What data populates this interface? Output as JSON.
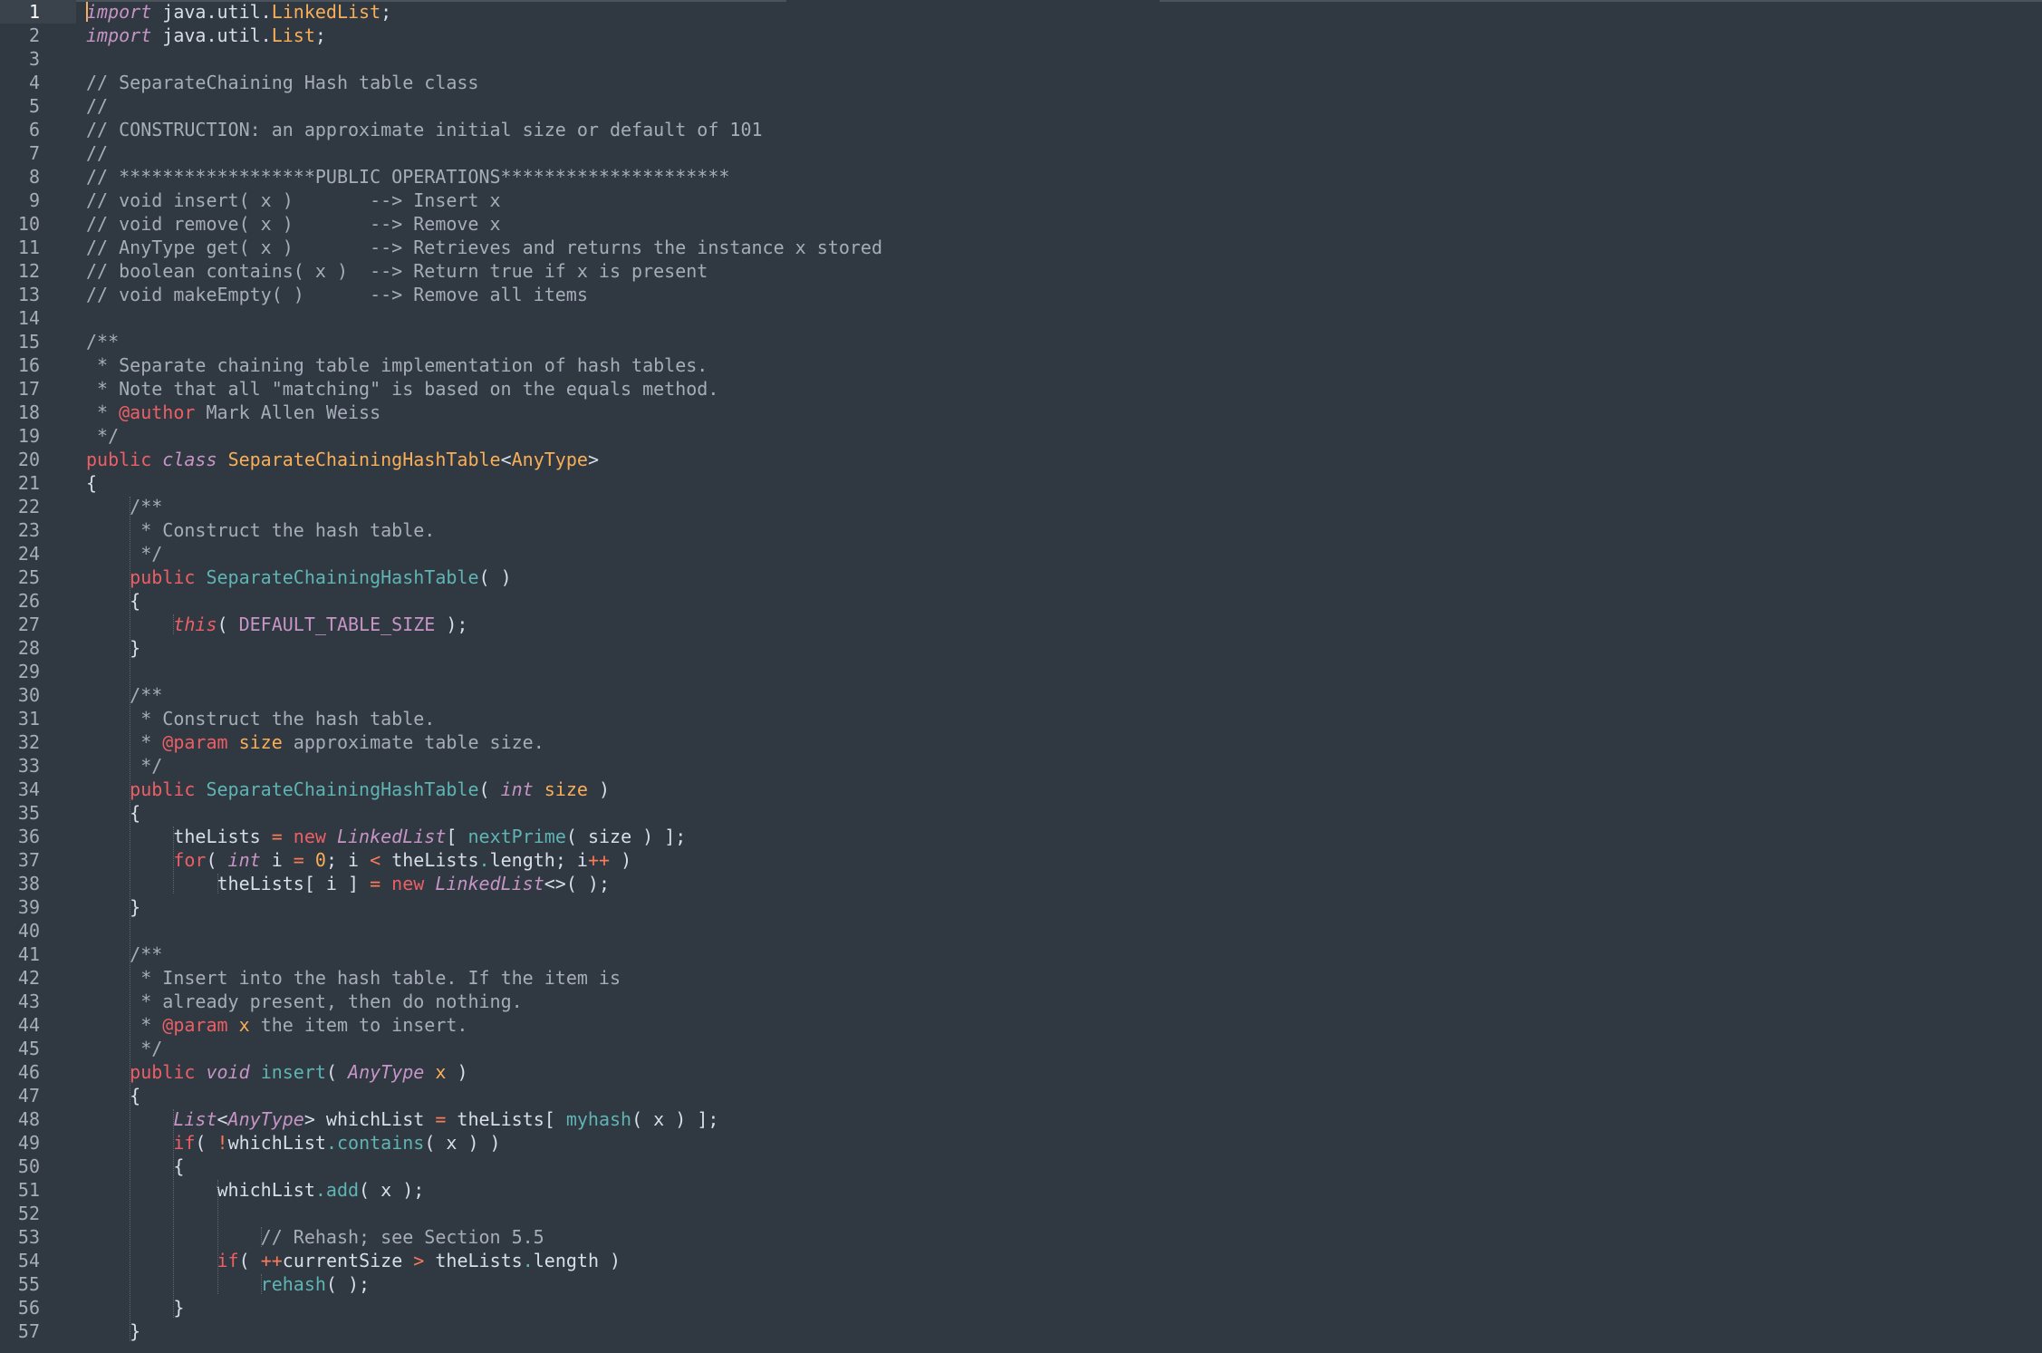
{
  "editor": {
    "current_line": 1,
    "theme_colors": {
      "background": "#303841",
      "gutter_text": "#a7adba",
      "keyword": "#ec5f66",
      "storage": "#c695c6",
      "class_name": "#f9ae58",
      "function": "#5fb4b4",
      "comment": "#a6acb9",
      "cursor": "#f9ae58"
    },
    "lines": [
      [
        [
          "kwi",
          "import"
        ],
        [
          "plain",
          " java.util."
        ],
        [
          "cls",
          "LinkedList"
        ],
        [
          "plain",
          ";"
        ]
      ],
      [
        [
          "kwi",
          "import"
        ],
        [
          "plain",
          " java.util."
        ],
        [
          "cls",
          "List"
        ],
        [
          "plain",
          ";"
        ]
      ],
      [],
      [
        [
          "com",
          "// SeparateChaining Hash table class"
        ]
      ],
      [
        [
          "com",
          "//"
        ]
      ],
      [
        [
          "com",
          "// CONSTRUCTION: an approximate initial size or default of 101"
        ]
      ],
      [
        [
          "com",
          "//"
        ]
      ],
      [
        [
          "com",
          "// ******************PUBLIC OPERATIONS*********************"
        ]
      ],
      [
        [
          "com",
          "// void insert( x )       --> Insert x"
        ]
      ],
      [
        [
          "com",
          "// void remove( x )       --> Remove x"
        ]
      ],
      [
        [
          "com",
          "// AnyType get( x )       --> Retrieves and returns the instance x stored"
        ]
      ],
      [
        [
          "com",
          "// boolean contains( x )  --> Return true if x is present"
        ]
      ],
      [
        [
          "com",
          "// void makeEmpty( )      --> Remove all items"
        ]
      ],
      [],
      [
        [
          "com",
          "/**"
        ]
      ],
      [
        [
          "com",
          " * Separate chaining table implementation of hash tables."
        ]
      ],
      [
        [
          "com",
          " * Note that all \"matching\" is based on the equals method."
        ]
      ],
      [
        [
          "com",
          " * "
        ],
        [
          "tag",
          "@author"
        ],
        [
          "com",
          " Mark Allen Weiss"
        ]
      ],
      [
        [
          "com",
          " */"
        ]
      ],
      [
        [
          "kw",
          "public"
        ],
        [
          "plain",
          " "
        ],
        [
          "kwi",
          "class"
        ],
        [
          "plain",
          " "
        ],
        [
          "cls",
          "SeparateChainingHashTable"
        ],
        [
          "plain",
          "<"
        ],
        [
          "cls",
          "AnyType"
        ],
        [
          "plain",
          ">"
        ]
      ],
      [
        [
          "plain",
          "{"
        ]
      ],
      [
        [
          "plain",
          "    "
        ],
        [
          "com",
          "/**"
        ]
      ],
      [
        [
          "plain",
          "    "
        ],
        [
          "com",
          " * Construct the hash table."
        ]
      ],
      [
        [
          "plain",
          "    "
        ],
        [
          "com",
          " */"
        ]
      ],
      [
        [
          "plain",
          "    "
        ],
        [
          "kw",
          "public"
        ],
        [
          "plain",
          " "
        ],
        [
          "fn",
          "SeparateChainingHashTable"
        ],
        [
          "plain",
          "( )"
        ]
      ],
      [
        [
          "plain",
          "    {"
        ]
      ],
      [
        [
          "plain",
          "        "
        ],
        [
          "kwr",
          "this"
        ],
        [
          "plain",
          "( "
        ],
        [
          "const",
          "DEFAULT_TABLE_SIZE"
        ],
        [
          "plain",
          " );"
        ]
      ],
      [
        [
          "plain",
          "    }"
        ]
      ],
      [],
      [
        [
          "plain",
          "    "
        ],
        [
          "com",
          "/**"
        ]
      ],
      [
        [
          "plain",
          "    "
        ],
        [
          "com",
          " * Construct the hash table."
        ]
      ],
      [
        [
          "plain",
          "    "
        ],
        [
          "com",
          " * "
        ],
        [
          "tag",
          "@param"
        ],
        [
          "com",
          " "
        ],
        [
          "par",
          "size"
        ],
        [
          "com",
          " approximate table size."
        ]
      ],
      [
        [
          "plain",
          "    "
        ],
        [
          "com",
          " */"
        ]
      ],
      [
        [
          "plain",
          "    "
        ],
        [
          "kw",
          "public"
        ],
        [
          "plain",
          " "
        ],
        [
          "fn",
          "SeparateChainingHashTable"
        ],
        [
          "plain",
          "( "
        ],
        [
          "kwi",
          "int"
        ],
        [
          "plain",
          " "
        ],
        [
          "par",
          "size"
        ],
        [
          "plain",
          " )"
        ]
      ],
      [
        [
          "plain",
          "    {"
        ]
      ],
      [
        [
          "plain",
          "        theLists "
        ],
        [
          "op",
          "="
        ],
        [
          "plain",
          " "
        ],
        [
          "kw",
          "new"
        ],
        [
          "plain",
          " "
        ],
        [
          "kwi",
          "LinkedList"
        ],
        [
          "plain",
          "[ "
        ],
        [
          "fn",
          "nextPrime"
        ],
        [
          "plain",
          "( size ) ];"
        ]
      ],
      [
        [
          "plain",
          "        "
        ],
        [
          "kw",
          "for"
        ],
        [
          "plain",
          "( "
        ],
        [
          "kwi",
          "int"
        ],
        [
          "plain",
          " i "
        ],
        [
          "op",
          "="
        ],
        [
          "plain",
          " "
        ],
        [
          "num",
          "0"
        ],
        [
          "plain",
          "; i "
        ],
        [
          "op",
          "<"
        ],
        [
          "plain",
          " theLists"
        ],
        [
          "pct",
          "."
        ],
        [
          "plain",
          "length; i"
        ],
        [
          "op",
          "++"
        ],
        [
          "plain",
          " )"
        ]
      ],
      [
        [
          "plain",
          "            theLists[ i ] "
        ],
        [
          "op",
          "="
        ],
        [
          "plain",
          " "
        ],
        [
          "kw",
          "new"
        ],
        [
          "plain",
          " "
        ],
        [
          "kwi",
          "LinkedList"
        ],
        [
          "plain",
          "<>( );"
        ]
      ],
      [
        [
          "plain",
          "    }"
        ]
      ],
      [],
      [
        [
          "plain",
          "    "
        ],
        [
          "com",
          "/**"
        ]
      ],
      [
        [
          "plain",
          "    "
        ],
        [
          "com",
          " * Insert into the hash table. If the item is"
        ]
      ],
      [
        [
          "plain",
          "    "
        ],
        [
          "com",
          " * already present, then do nothing."
        ]
      ],
      [
        [
          "plain",
          "    "
        ],
        [
          "com",
          " * "
        ],
        [
          "tag",
          "@param"
        ],
        [
          "com",
          " "
        ],
        [
          "par",
          "x"
        ],
        [
          "com",
          " the item to insert."
        ]
      ],
      [
        [
          "plain",
          "    "
        ],
        [
          "com",
          " */"
        ]
      ],
      [
        [
          "plain",
          "    "
        ],
        [
          "kw",
          "public"
        ],
        [
          "plain",
          " "
        ],
        [
          "kwi",
          "void"
        ],
        [
          "plain",
          " "
        ],
        [
          "fn",
          "insert"
        ],
        [
          "plain",
          "( "
        ],
        [
          "kwi",
          "AnyType"
        ],
        [
          "plain",
          " "
        ],
        [
          "par",
          "x"
        ],
        [
          "plain",
          " )"
        ]
      ],
      [
        [
          "plain",
          "    {"
        ]
      ],
      [
        [
          "plain",
          "        "
        ],
        [
          "kwi",
          "List"
        ],
        [
          "plain",
          "<"
        ],
        [
          "kwi",
          "AnyType"
        ],
        [
          "plain",
          "> whichList "
        ],
        [
          "op",
          "="
        ],
        [
          "plain",
          " theLists[ "
        ],
        [
          "fn",
          "myhash"
        ],
        [
          "plain",
          "( x ) ];"
        ]
      ],
      [
        [
          "plain",
          "        "
        ],
        [
          "kw",
          "if"
        ],
        [
          "plain",
          "( "
        ],
        [
          "op",
          "!"
        ],
        [
          "plain",
          "whichList"
        ],
        [
          "pct",
          "."
        ],
        [
          "fn",
          "contains"
        ],
        [
          "plain",
          "( x ) )"
        ]
      ],
      [
        [
          "plain",
          "        {"
        ]
      ],
      [
        [
          "plain",
          "            whichList"
        ],
        [
          "pct",
          "."
        ],
        [
          "fn",
          "add"
        ],
        [
          "plain",
          "( x );"
        ]
      ],
      [],
      [
        [
          "plain",
          "                "
        ],
        [
          "com",
          "// Rehash; see Section 5.5"
        ]
      ],
      [
        [
          "plain",
          "            "
        ],
        [
          "kw",
          "if"
        ],
        [
          "plain",
          "( "
        ],
        [
          "op",
          "++"
        ],
        [
          "plain",
          "currentSize "
        ],
        [
          "op",
          ">"
        ],
        [
          "plain",
          " theLists"
        ],
        [
          "pct",
          "."
        ],
        [
          "plain",
          "length )"
        ]
      ],
      [
        [
          "plain",
          "                "
        ],
        [
          "fn",
          "rehash"
        ],
        [
          "plain",
          "( );"
        ]
      ],
      [
        [
          "plain",
          "        }"
        ]
      ],
      [
        [
          "plain",
          "    }"
        ]
      ]
    ]
  }
}
